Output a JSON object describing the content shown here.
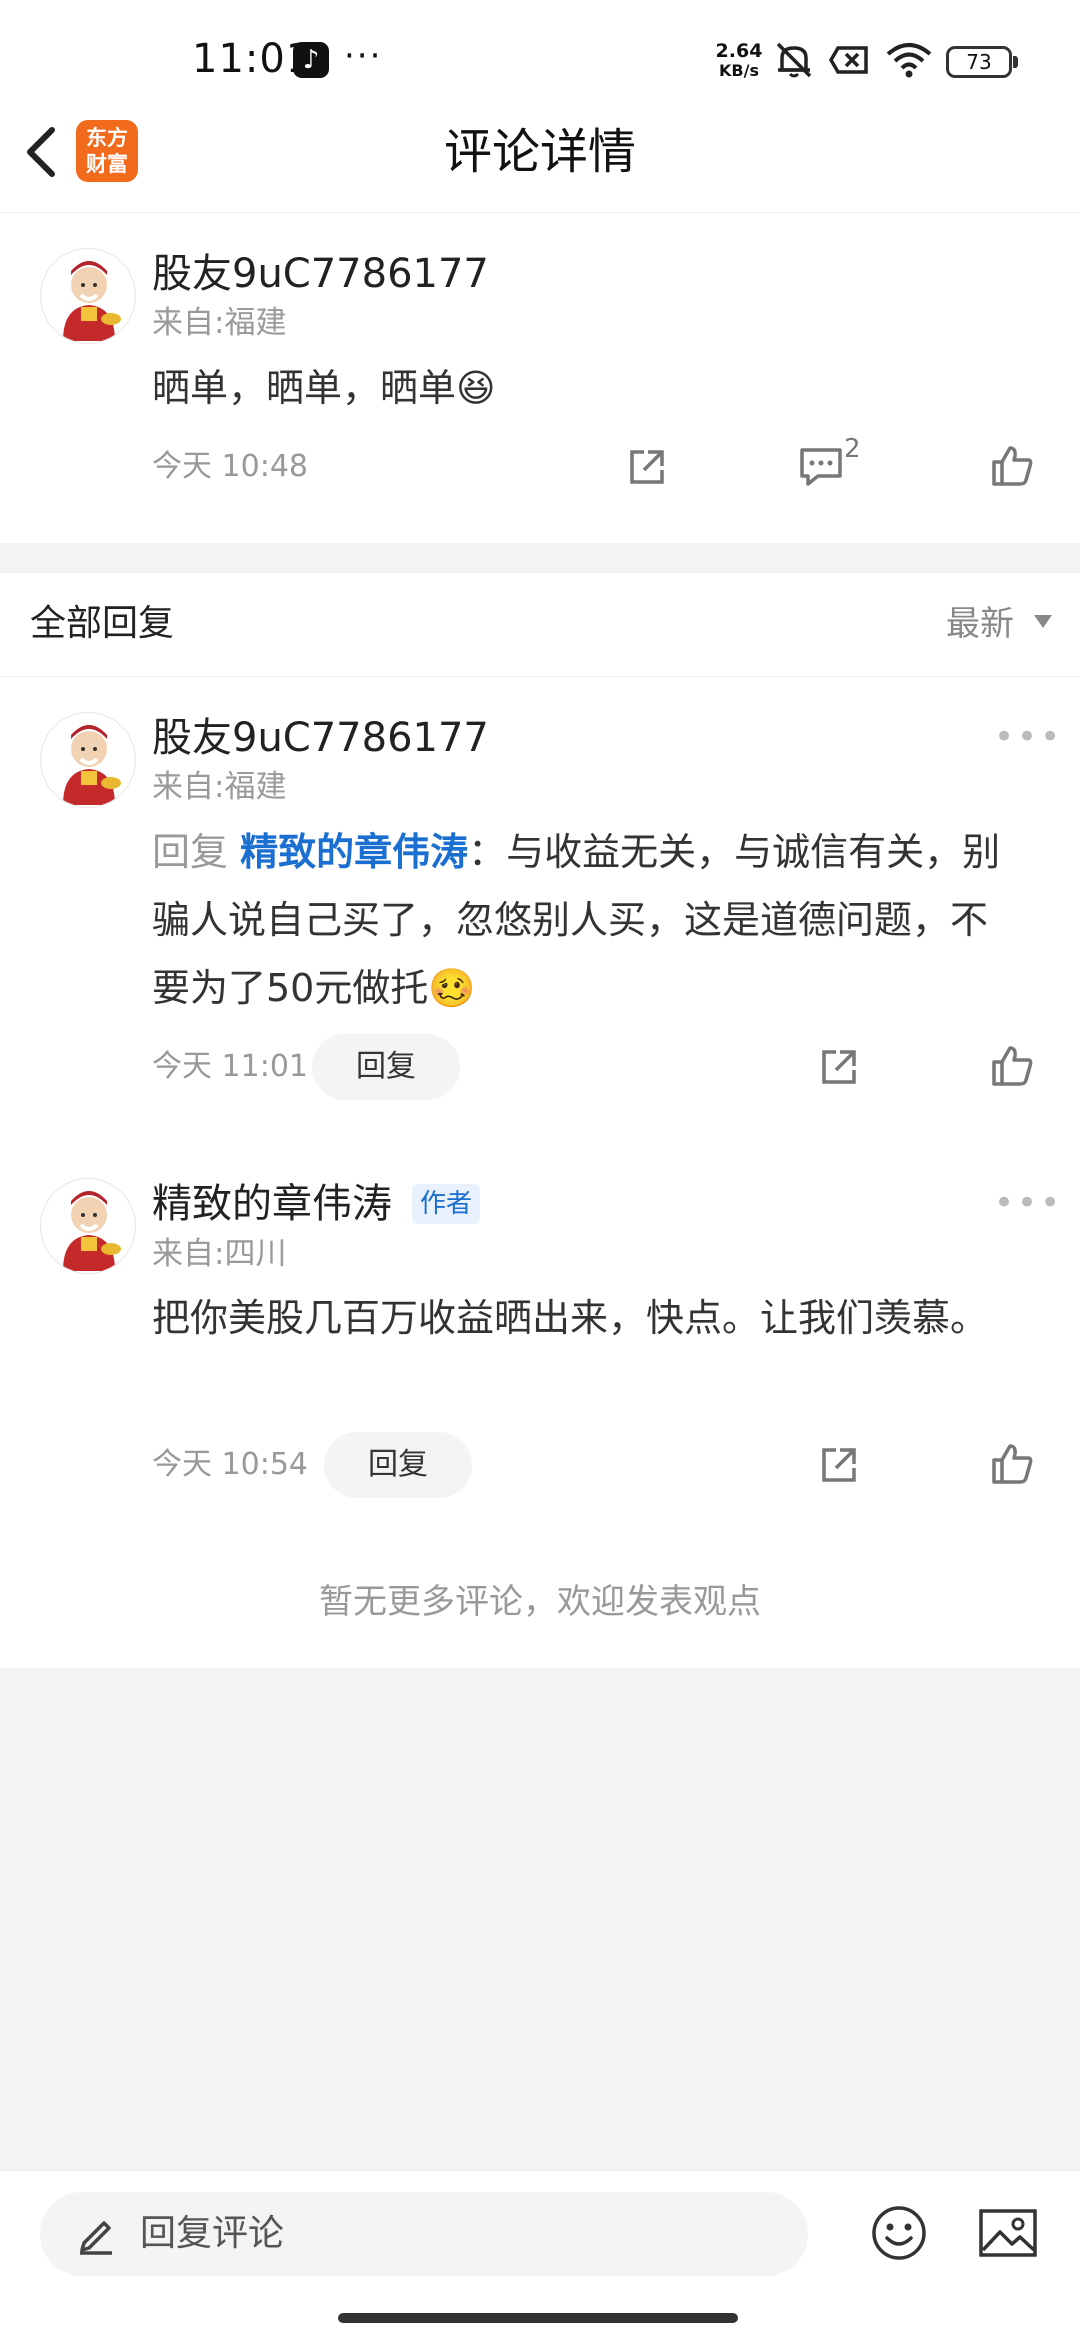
{
  "status_bar": {
    "time": "11:01",
    "more": "···",
    "net_speed_value": "2.64",
    "net_speed_unit": "KB/s",
    "battery": "73"
  },
  "header": {
    "title": "评论详情",
    "logo_line1": "东方",
    "logo_line2": "财富"
  },
  "main_comment": {
    "username": "股友9uC7786177",
    "location": "来自:福建",
    "text": "晒单，晒单，晒单",
    "emoji": "😆",
    "time": "今天 10:48",
    "comment_count": "2"
  },
  "replies_section": {
    "label": "全部回复",
    "sort": "最新"
  },
  "replies": [
    {
      "username": "股友9uC7786177",
      "location": "来自:福建",
      "reply_prefix": "回复 ",
      "mention": "精致的章伟涛",
      "text": "：与收益无关，与诚信有关，别骗人说自己买了，忽悠别人买，这是道德问题，不要为了50元做托",
      "emoji": "🥴",
      "time": "今天 11:01",
      "reply_label": "回复"
    },
    {
      "username": "精致的章伟涛",
      "badge": "作者",
      "location": "来自:四川",
      "text": "把你美股几百万收益晒出来，快点。让我们羡慕。",
      "time": "今天 10:54",
      "reply_label": "回复"
    }
  ],
  "footer_text": "暂无更多评论，欢迎发表观点",
  "bottom_bar": {
    "placeholder": "回复评论"
  },
  "colors": {
    "accent_blue": "#1a6fd1",
    "brand_orange": "#f26a1b"
  },
  "icons": [
    "back-arrow-icon",
    "share-icon",
    "comment-icon",
    "like-icon",
    "more-icon",
    "pencil-icon",
    "emoji-icon",
    "image-icon",
    "wifi-icon",
    "mute-icon",
    "sim-icon"
  ]
}
